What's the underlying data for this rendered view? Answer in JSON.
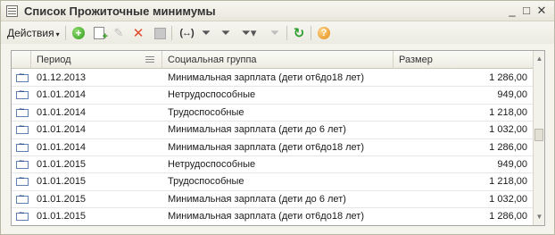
{
  "window": {
    "title": "Список Прожиточные минимумы",
    "minimize_glyph": "_",
    "maximize_glyph": "□",
    "close_glyph": "✕"
  },
  "toolbar": {
    "actions_label": "Действия",
    "actions_caret": "▾",
    "buttons": [
      {
        "name": "add-icon",
        "glyph": "+"
      },
      {
        "name": "copy-icon"
      },
      {
        "name": "edit-icon",
        "glyph": "✎"
      },
      {
        "name": "delete-icon",
        "glyph": "✕"
      },
      {
        "name": "save-icon"
      },
      {
        "name": "period-icon",
        "glyph": "(↔)"
      },
      {
        "name": "filter-icon",
        "glyph": "⏷"
      },
      {
        "name": "filter-settings-icon",
        "glyph": "⏷"
      },
      {
        "name": "filter-dropdown-icon",
        "glyph": "⏷▾"
      },
      {
        "name": "filter-clear-icon",
        "glyph": "⏷"
      },
      {
        "name": "refresh-icon",
        "glyph": "↻"
      },
      {
        "name": "help-icon",
        "glyph": "?"
      }
    ]
  },
  "grid": {
    "columns": [
      "Период",
      "Социальная группа",
      "Размер"
    ],
    "sort_column": "Период",
    "rows": [
      {
        "period": "01.12.2013",
        "group": "Минимальная зарплата (дети от6до18 лет)",
        "amount": "1 286,00"
      },
      {
        "period": "01.01.2014",
        "group": "Нетрудоспособные",
        "amount": "949,00"
      },
      {
        "period": "01.01.2014",
        "group": "Трудоспособные",
        "amount": "1 218,00"
      },
      {
        "period": "01.01.2014",
        "group": "Минимальная зарплата (дети до 6 лет)",
        "amount": "1 032,00"
      },
      {
        "period": "01.01.2014",
        "group": "Минимальная зарплата (дети от6до18 лет)",
        "amount": "1 286,00"
      },
      {
        "period": "01.01.2015",
        "group": "Нетрудоспособные",
        "amount": "949,00"
      },
      {
        "period": "01.01.2015",
        "group": "Трудоспособные",
        "amount": "1 218,00"
      },
      {
        "period": "01.01.2015",
        "group": "Минимальная зарплата (дети до 6 лет)",
        "amount": "1 032,00"
      },
      {
        "period": "01.01.2015",
        "group": "Минимальная зарплата (дети от6до18 лет)",
        "amount": "1 286,00"
      }
    ]
  },
  "scrollbar": {
    "up_glyph": "▲",
    "down_glyph": "▼"
  }
}
